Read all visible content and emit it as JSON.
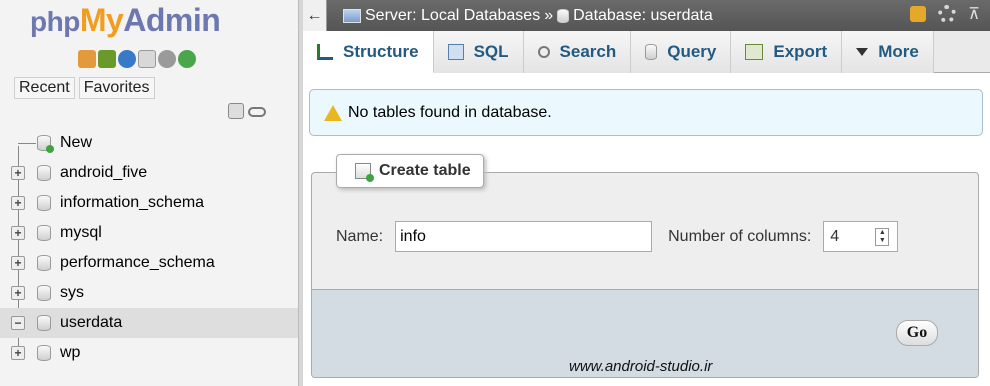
{
  "sidebar": {
    "logo": {
      "php": "php",
      "my": "My",
      "admin": "Admin"
    },
    "icons": [
      "home-icon",
      "exit-icon",
      "help-icon",
      "docs-icon",
      "settings-icon",
      "reload-icon"
    ],
    "recent_label": "Recent",
    "favorites_label": "Favorites",
    "tree": [
      {
        "label": "New",
        "expand": ""
      },
      {
        "label": "android_five",
        "expand": "+"
      },
      {
        "label": "information_schema",
        "expand": "+"
      },
      {
        "label": "mysql",
        "expand": "+"
      },
      {
        "label": "performance_schema",
        "expand": "+"
      },
      {
        "label": "sys",
        "expand": "+"
      },
      {
        "label": "userdata",
        "expand": "−",
        "selected": true
      },
      {
        "label": "wp",
        "expand": "+"
      }
    ]
  },
  "breadcrumb": {
    "server": "Server: Local Databases",
    "separator": "»",
    "database": "Database: userdata"
  },
  "tabs": [
    {
      "label": "Structure",
      "icon": "structure-icon",
      "active": true
    },
    {
      "label": "SQL",
      "icon": "sql-icon"
    },
    {
      "label": "Search",
      "icon": "search-icon"
    },
    {
      "label": "Query",
      "icon": "query-icon"
    },
    {
      "label": "Export",
      "icon": "export-icon"
    },
    {
      "label": "More",
      "icon": "chevron-down-icon"
    }
  ],
  "notice": "No tables found in database.",
  "create_table": {
    "legend": "Create table",
    "name_label": "Name:",
    "name_value": "info",
    "columns_label": "Number of columns:",
    "columns_value": "4",
    "go_label": "Go"
  },
  "watermark": "www.android-studio.ir",
  "colors": {
    "accent": "#235a81",
    "logo_orange": "#f29d1e",
    "logo_blue": "#6c78af"
  }
}
